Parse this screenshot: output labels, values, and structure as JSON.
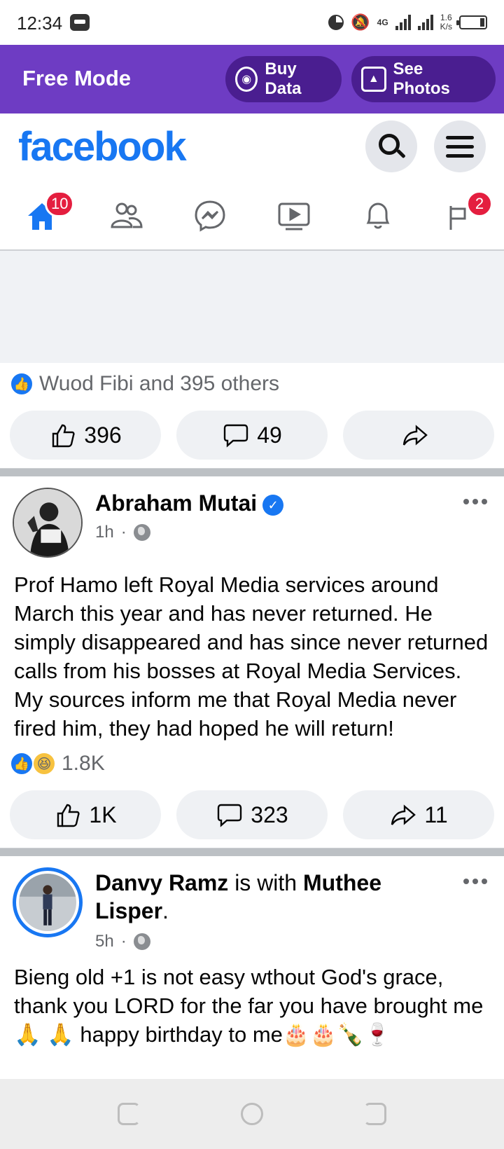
{
  "status_bar": {
    "time": "12:34",
    "network": "4G",
    "speed_value": "1.6",
    "speed_unit": "K/s"
  },
  "banner": {
    "title": "Free Mode",
    "buy_data_label": "Buy Data",
    "see_photos_label": "See Photos"
  },
  "header": {
    "logo": "facebook"
  },
  "tabs": [
    {
      "name": "home",
      "badge": "10",
      "active": true
    },
    {
      "name": "friends",
      "badge": null
    },
    {
      "name": "messenger",
      "badge": null
    },
    {
      "name": "watch",
      "badge": null
    },
    {
      "name": "notifications",
      "badge": null
    },
    {
      "name": "marketplace",
      "badge": "2"
    }
  ],
  "prev_post": {
    "reactions_text": "Wuod Fibi and 395 others",
    "likes": "396",
    "comments": "49",
    "shares": ""
  },
  "post1": {
    "author": "Abraham Mutai",
    "time": "1h",
    "text": "Prof Hamo left Royal Media services around March this year and has never returned. He simply disappeared and has since never returned calls from his bosses at Royal Media Services. My sources inform me that Royal Media never fired him, they had hoped he will return!",
    "reactions_count": "1.8K",
    "likes": "1K",
    "comments": "323",
    "shares": "11"
  },
  "post2": {
    "author": "Danvy Ramz",
    "with_text": " is with ",
    "tagged": "Muthee Lisper",
    "period": ".",
    "time": "5h",
    "text": "Bieng old +1 is not easy wthout God's grace, thank you LORD for the far you have brought me 🙏 🙏 happy birthday to me🎂🎂🍾🍷"
  },
  "colors": {
    "brand": "#1877f2",
    "banner": "#6e3cc3",
    "badge": "#e41e3f"
  }
}
